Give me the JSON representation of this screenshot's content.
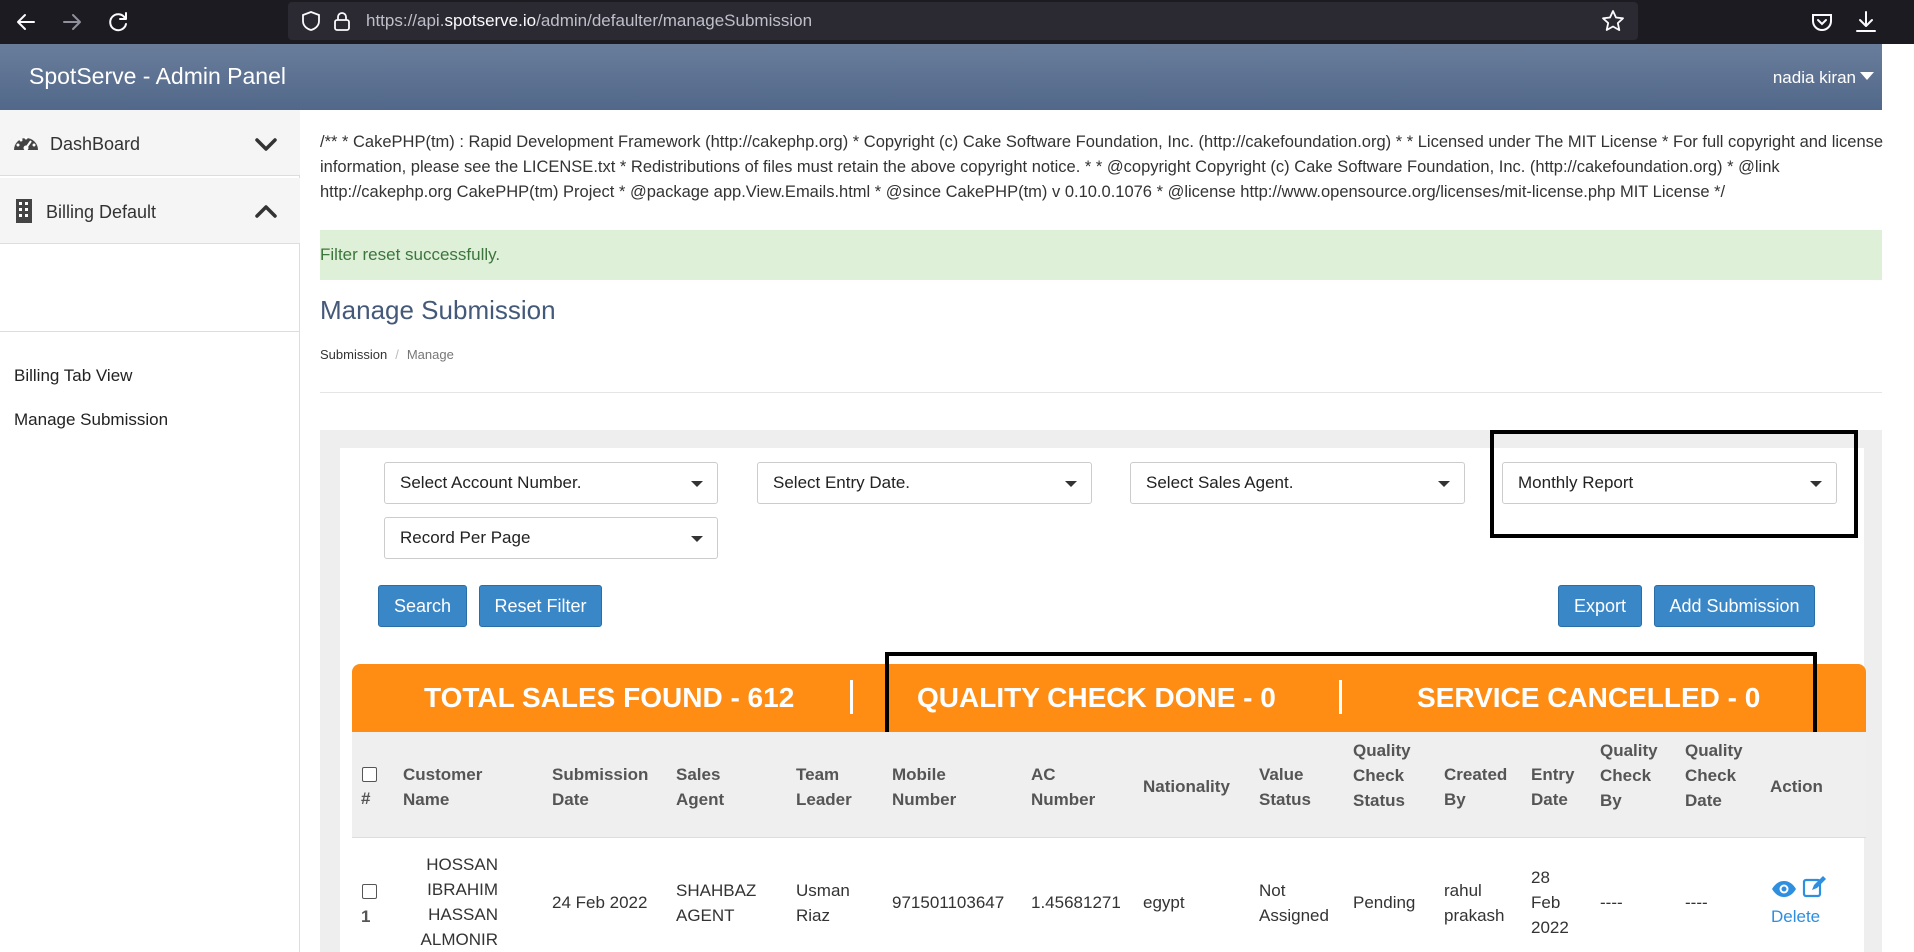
{
  "browser": {
    "url_prefix": "https://api.",
    "url_host": "spotserve.io",
    "url_path": "/admin/defaulter/manageSubmission"
  },
  "header": {
    "app_title": "SpotServe - Admin Panel",
    "user_name": "nadia kiran"
  },
  "sidebar": {
    "sections": [
      {
        "label": "DashBoard",
        "icon": "dashboard-icon",
        "state": "collapsed"
      },
      {
        "label": "Billing Default",
        "icon": "building-icon",
        "state": "expanded"
      }
    ],
    "links": [
      "Billing Tab View",
      "Manage Submission"
    ]
  },
  "main": {
    "license_text": "/** * CakePHP(tm) : Rapid Development Framework (http://cakephp.org) * Copyright (c) Cake Software Foundation, Inc. (http://cakefoundation.org) * * Licensed under The MIT License * For full copyright and license information, please see the LICENSE.txt * Redistributions of files must retain the above copyright notice. * * @copyright Copyright (c) Cake Software Foundation, Inc. (http://cakefoundation.org) * @link http://cakephp.org CakePHP(tm) Project * @package app.View.Emails.html * @since CakePHP(tm) v 0.10.0.1076 * @license http://www.opensource.org/licenses/mit-license.php MIT License */",
    "alert": "Filter reset successfully.",
    "page_title": "Manage Submission",
    "breadcrumb": {
      "first": "Submission",
      "separator": "/",
      "current": "Manage"
    }
  },
  "filters": {
    "account_number": "Select Account Number.",
    "entry_date": "Select Entry Date.",
    "sales_agent": "Select Sales Agent.",
    "report": "Monthly Report",
    "record_per_page": "Record Per Page"
  },
  "buttons": {
    "search": "Search",
    "reset": "Reset Filter",
    "export": "Export",
    "add": "Add Submission"
  },
  "summary": {
    "total_sales": "TOTAL SALES FOUND - 612",
    "quality_check": "QUALITY CHECK DONE - 0",
    "service_cancelled": "SERVICE CANCELLED - 0"
  },
  "table": {
    "headers": {
      "index": "#",
      "customer_name": [
        "Customer",
        "Name"
      ],
      "submission_date": [
        "Submission",
        "Date"
      ],
      "sales_agent": [
        "Sales",
        "Agent"
      ],
      "team_leader": [
        "Team",
        "Leader"
      ],
      "mobile_number": [
        "Mobile",
        "Number"
      ],
      "ac_number": [
        "AC",
        "Number"
      ],
      "nationality": "Nationality",
      "value_status": [
        "Value",
        "Status"
      ],
      "qc_status": [
        "Quality",
        "Check",
        "Status"
      ],
      "created_by": [
        "Created",
        "By"
      ],
      "entry_date": [
        "Entry",
        "Date"
      ],
      "qc_by": [
        "Quality",
        "Check",
        "By"
      ],
      "qc_date": [
        "Quality",
        "Check",
        "Date"
      ],
      "action": "Action"
    },
    "rows": [
      {
        "index": "1",
        "customer_name": [
          "HOSSAN",
          "IBRAHIM",
          "HASSAN",
          "ALMONIR"
        ],
        "submission_date": "24 Feb 2022",
        "sales_agent": [
          "SHAHBAZ",
          "AGENT"
        ],
        "team_leader": [
          "Usman",
          "Riaz"
        ],
        "mobile_number": "971501103647",
        "ac_number": "1.45681271",
        "nationality": "egypt",
        "value_status": [
          "Not",
          "Assigned"
        ],
        "qc_status": "Pending",
        "created_by": [
          "rahul",
          "prakash"
        ],
        "entry_date": [
          "28",
          "Feb",
          "2022"
        ],
        "qc_by": "----",
        "qc_date": "----",
        "action_delete": "Delete"
      }
    ]
  },
  "colors": {
    "header_bg": "#5b6f8f",
    "summary_bg": "#ff8c13",
    "button_bg": "#3a87c8",
    "alert_bg": "#dff0d8",
    "alert_text": "#3c763d",
    "link": "#2e8ee0"
  }
}
